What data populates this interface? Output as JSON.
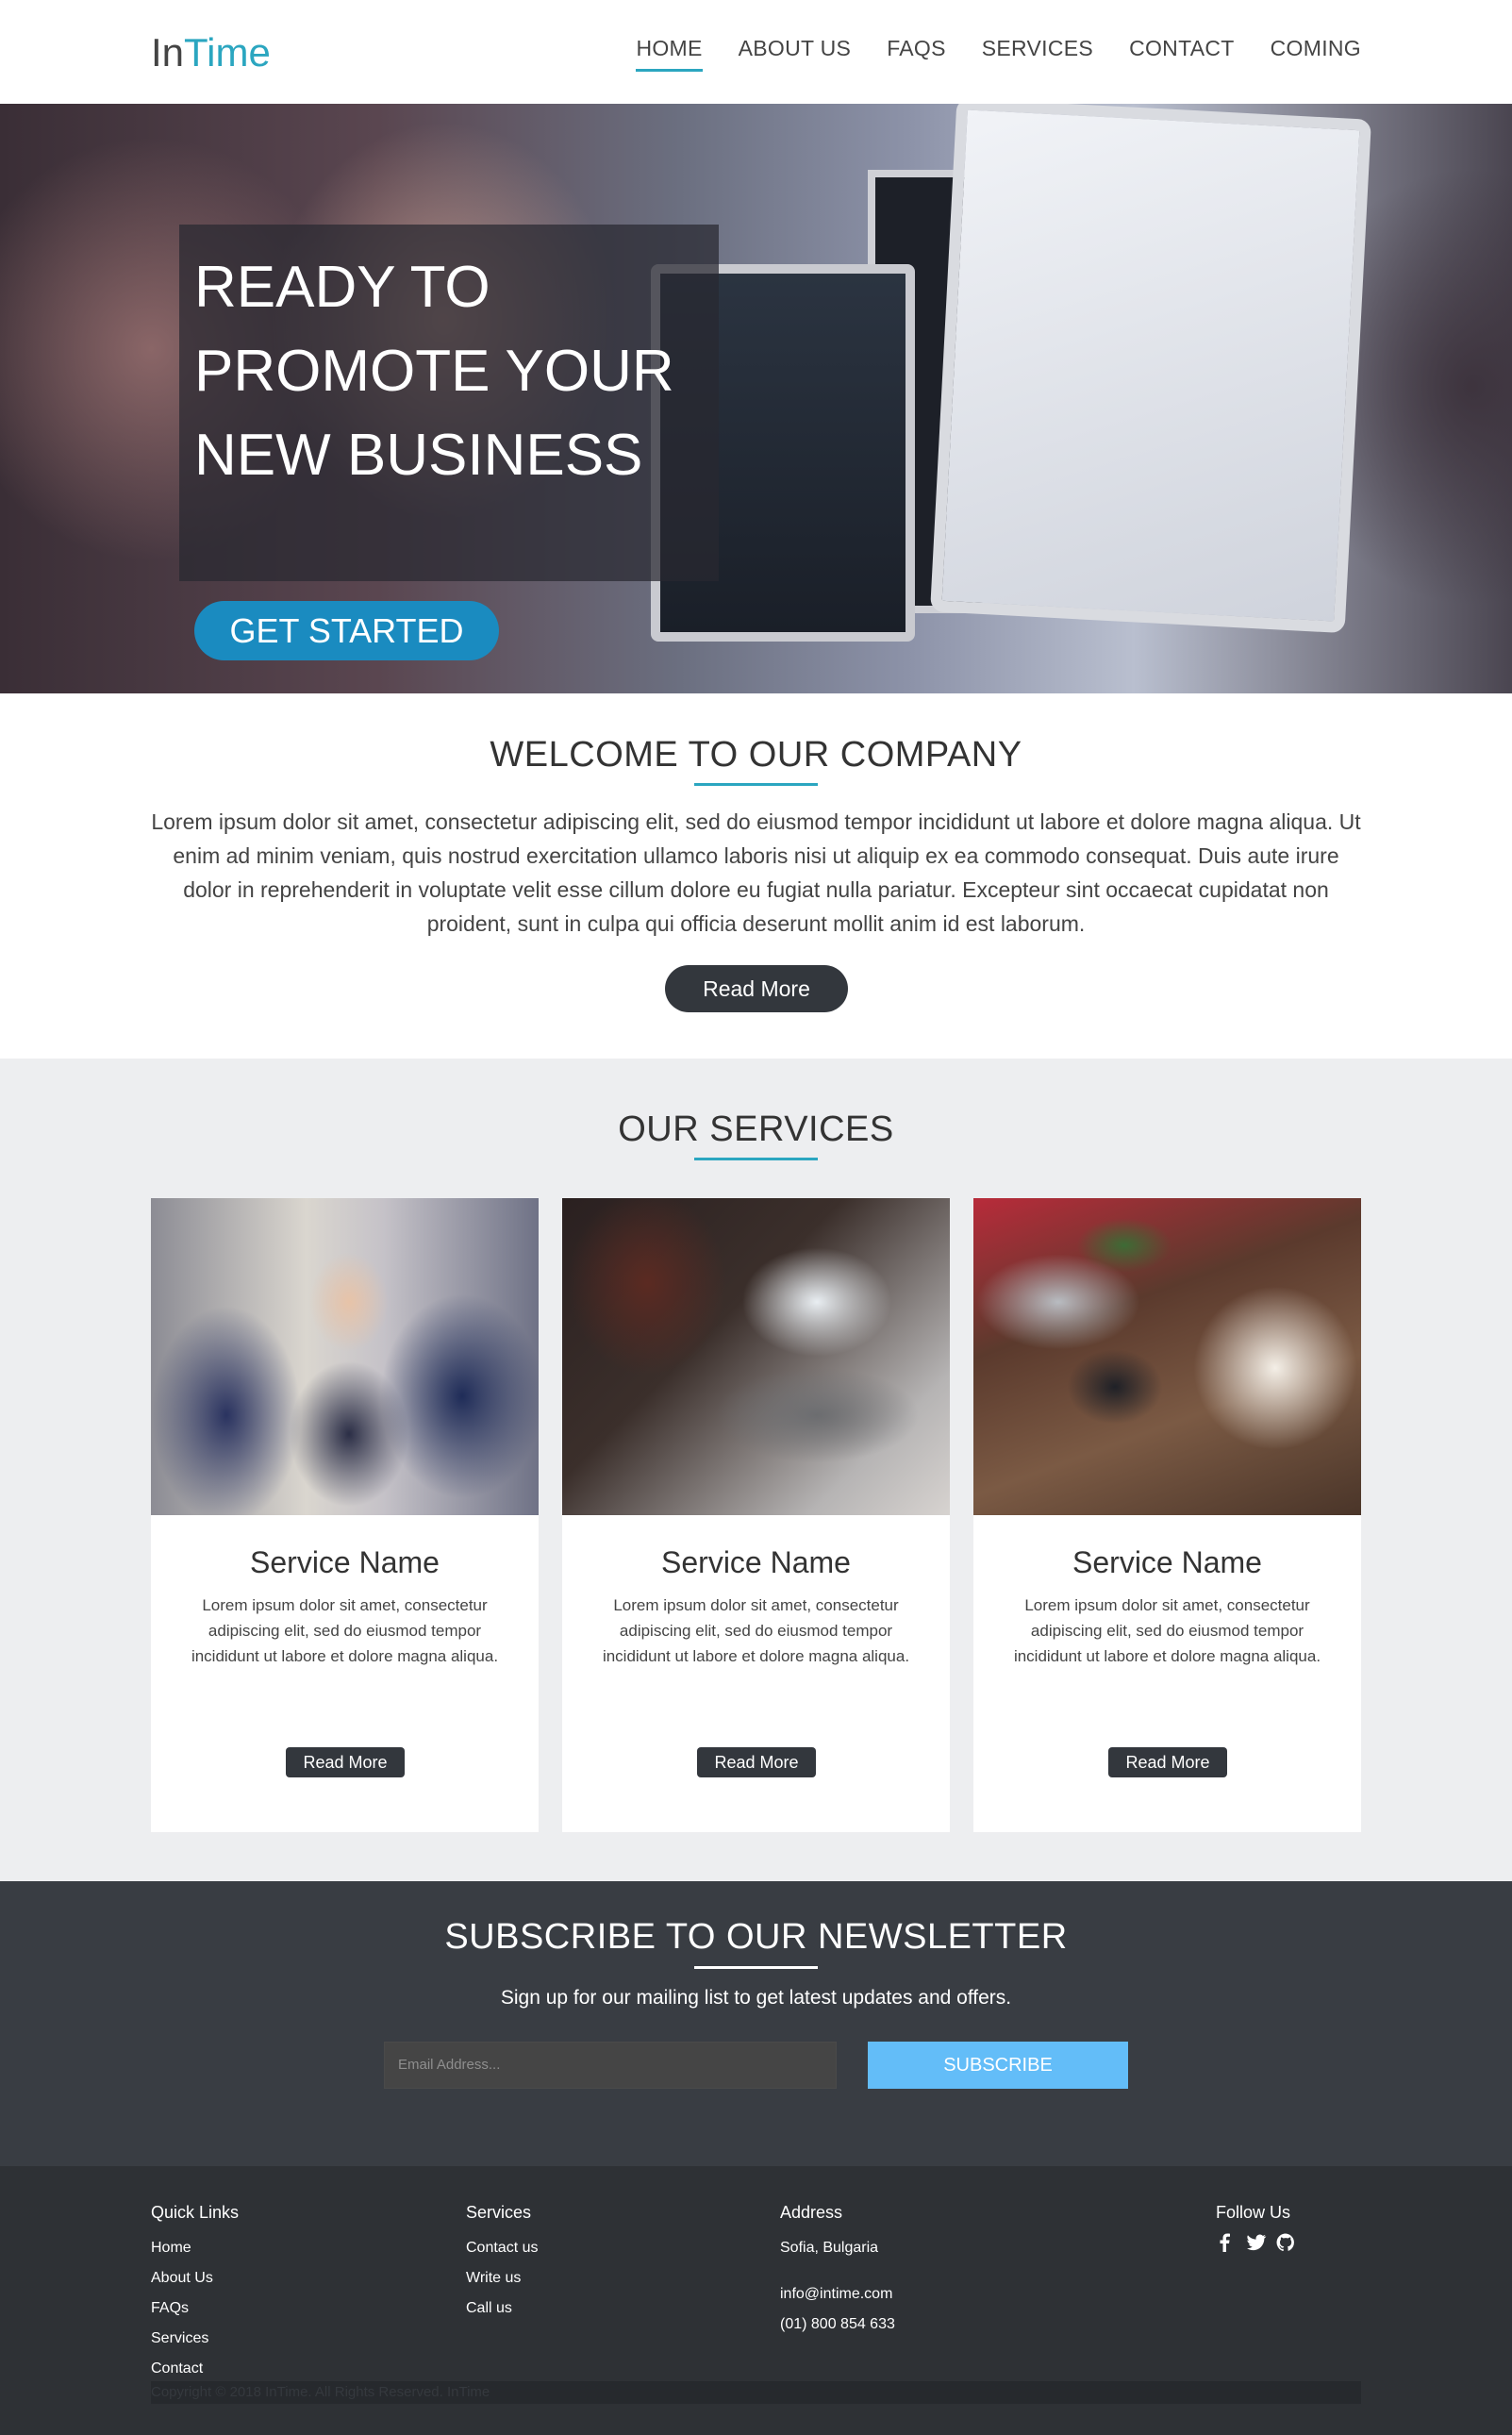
{
  "brand": {
    "part1": "In",
    "part2": "Time"
  },
  "nav": {
    "items": [
      "HOME",
      "ABOUT US",
      "FAQS",
      "SERVICES",
      "CONTACT",
      "COMING"
    ],
    "active": "HOME"
  },
  "hero": {
    "line1": "READY TO",
    "line2": "PROMOTE YOUR",
    "line3": "NEW BUSINESS",
    "cta": "GET STARTED"
  },
  "welcome": {
    "title": "WELCOME TO OUR COMPANY",
    "text": "Lorem ipsum dolor sit amet, consectetur adipiscing elit, sed do eiusmod tempor incididunt ut labore et dolore magna aliqua. Ut enim ad minim veniam, quis nostrud exercitation ullamco laboris nisi ut aliquip ex ea commodo consequat. Duis aute irure dolor in reprehenderit in voluptate velit esse cillum dolore eu fugiat nulla pariatur. Excepteur sint occaecat cupidatat non proident, sunt in culpa qui officia deserunt mollit anim id est laborum.",
    "button": "Read More"
  },
  "services": {
    "title": "OUR SERVICES",
    "cards": [
      {
        "title": "Service Name",
        "text": "Lorem ipsum dolor sit amet, consectetur adipiscing elit, sed do eiusmod tempor incididunt ut labore et dolore magna aliqua.",
        "button": "Read More"
      },
      {
        "title": "Service Name",
        "text": "Lorem ipsum dolor sit amet, consectetur adipiscing elit, sed do eiusmod tempor incididunt ut labore et dolore magna aliqua.",
        "button": "Read More"
      },
      {
        "title": "Service Name",
        "text": "Lorem ipsum dolor sit amet, consectetur adipiscing elit, sed do eiusmod tempor incididunt ut labore et dolore magna aliqua.",
        "button": "Read More"
      }
    ]
  },
  "newsletter": {
    "title": "SUBSCRIBE TO OUR NEWSLETTER",
    "subtitle": "Sign up for our mailing list to get latest updates and offers.",
    "placeholder": "Email Address...",
    "button": "SUBSCRIBE"
  },
  "footer": {
    "quick_links": {
      "heading": "Quick Links",
      "items": [
        "Home",
        "About Us",
        "FAQs",
        "Services",
        "Contact"
      ]
    },
    "services": {
      "heading": "Services",
      "items": [
        "Contact us",
        "Write us",
        "Call us"
      ]
    },
    "address": {
      "heading": "Address",
      "city": "Sofia, Bulgaria",
      "email": "info@intime.com",
      "phone": "(01) 800 854 633"
    },
    "follow": {
      "heading": "Follow Us",
      "icons": [
        "facebook-icon",
        "twitter-icon",
        "github-icon"
      ]
    },
    "copyright": "Copyright © 2018 InTime. All Rights Reserved. InTime"
  },
  "colors": {
    "accent": "#2ba6c0",
    "cta_blue": "#1a8bc0",
    "subscribe_blue": "#63bdf8",
    "dark": "#393d43",
    "footer": "#2e3135"
  }
}
